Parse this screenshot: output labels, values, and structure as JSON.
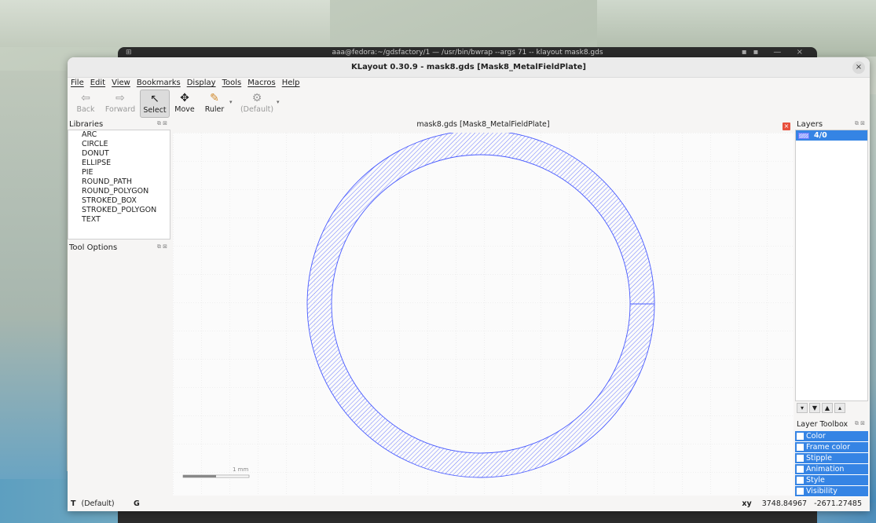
{
  "terminal": {
    "title": "aaa@fedora:~/gdsfactory/1 — /usr/bin/bwrap --args 71 -- klayout mask8.gds"
  },
  "window": {
    "title": "KLayout 0.30.9 - mask8.gds [Mask8_MetalFieldPlate]",
    "close_symbol": "×"
  },
  "menu": [
    "File",
    "Edit",
    "View",
    "Bookmarks",
    "Display",
    "Tools",
    "Macros",
    "Help"
  ],
  "toolbar": {
    "back": "Back",
    "forward": "Forward",
    "select": "Select",
    "move": "Move",
    "ruler": "Ruler",
    "default": "(Default)"
  },
  "libraries": {
    "header": "Libraries",
    "items": [
      "ARC",
      "CIRCLE",
      "DONUT",
      "ELLIPSE",
      "PIE",
      "ROUND_PATH",
      "ROUND_POLYGON",
      "STROKED_BOX",
      "STROKED_POLYGON",
      "TEXT"
    ]
  },
  "tool_options": {
    "header": "Tool Options"
  },
  "canvas": {
    "title": "mask8.gds [Mask8_MetalFieldPlate]",
    "scale_label": "1 mm",
    "shape_color": "#4a5cff"
  },
  "layers": {
    "header": "Layers",
    "items": [
      {
        "name": "4/0"
      }
    ]
  },
  "layer_toolbox": {
    "header": "Layer Toolbox",
    "items": [
      "Color",
      "Frame color",
      "Stipple",
      "Animation",
      "Style",
      "Visibility"
    ]
  },
  "status": {
    "mode_letter": "T",
    "mode_value": "(Default)",
    "grid_letter": "G",
    "coord_label": "xy",
    "x": "3748.84967",
    "y": "-2671.27485"
  }
}
